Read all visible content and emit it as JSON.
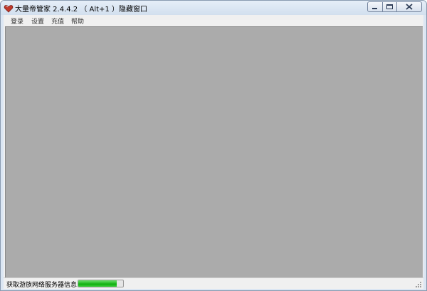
{
  "window": {
    "title": "大量帝管家 2.4.4.2 （ Alt+1 ）隐藏窗口",
    "icon": "app-heart-icon",
    "buttons": [
      "minimize-icon",
      "maximize-icon",
      "close-icon"
    ]
  },
  "menu": {
    "items": [
      {
        "label": "登录"
      },
      {
        "label": "设置"
      },
      {
        "label": "充值"
      },
      {
        "label": "帮助"
      }
    ]
  },
  "status": {
    "text": "获取游族网络服务器信息......",
    "progress_percent": 85
  },
  "colors": {
    "content_background": "#ababab",
    "progress_fill": "#10b010",
    "chrome": "#f0f0f0"
  }
}
